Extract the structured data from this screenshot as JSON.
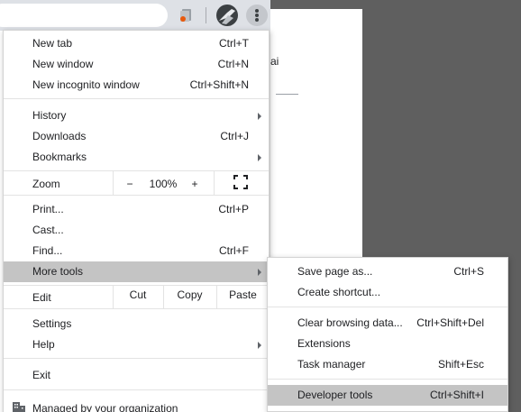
{
  "browser": {
    "page_text_fragment": "ai",
    "extension_icon": "extension-icon",
    "profile_icon": "profile-avatar-icon",
    "menu_icon": "kebab-menu-icon"
  },
  "menu": {
    "new_tab": {
      "label": "New tab",
      "shortcut": "Ctrl+T"
    },
    "new_window": {
      "label": "New window",
      "shortcut": "Ctrl+N"
    },
    "new_incognito": {
      "label": "New incognito window",
      "shortcut": "Ctrl+Shift+N"
    },
    "history": {
      "label": "History"
    },
    "downloads": {
      "label": "Downloads",
      "shortcut": "Ctrl+J"
    },
    "bookmarks": {
      "label": "Bookmarks"
    },
    "zoom": {
      "label": "Zoom",
      "minus": "−",
      "value": "100%",
      "plus": "+"
    },
    "print": {
      "label": "Print...",
      "shortcut": "Ctrl+P"
    },
    "cast": {
      "label": "Cast..."
    },
    "find": {
      "label": "Find...",
      "shortcut": "Ctrl+F"
    },
    "more_tools": {
      "label": "More tools"
    },
    "edit": {
      "label": "Edit",
      "cut": "Cut",
      "copy": "Copy",
      "paste": "Paste"
    },
    "settings": {
      "label": "Settings"
    },
    "help": {
      "label": "Help"
    },
    "exit": {
      "label": "Exit"
    },
    "managed": {
      "label": "Managed by your organization"
    }
  },
  "submenu": {
    "save_page": {
      "label": "Save page as...",
      "shortcut": "Ctrl+S"
    },
    "create_shortcut": {
      "label": "Create shortcut..."
    },
    "clear_data": {
      "label": "Clear browsing data...",
      "shortcut": "Ctrl+Shift+Del"
    },
    "extensions": {
      "label": "Extensions"
    },
    "task_manager": {
      "label": "Task manager",
      "shortcut": "Shift+Esc"
    },
    "developer_tools": {
      "label": "Developer tools",
      "shortcut": "Ctrl+Shift+I"
    }
  },
  "colors": {
    "highlight": "#c4c4c4",
    "toolbar": "#dee1e6",
    "backdrop": "#5f5f5f"
  }
}
